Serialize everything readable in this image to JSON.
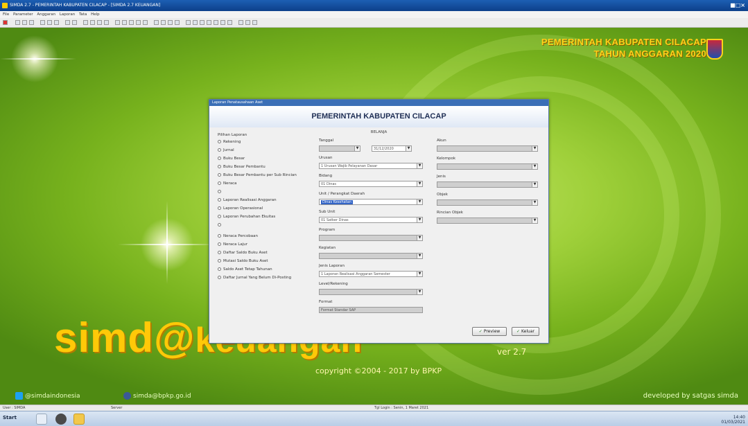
{
  "window": {
    "title": "SIMDA 2.7 - PEMERINTAH KABUPATEN CILACAP - [SIMDA 2.7 KEUANGAN]",
    "controls": "■□×"
  },
  "menu": [
    "File",
    "Parameter",
    "Anggaran",
    "Laporan",
    "Tata",
    "Help"
  ],
  "banner": {
    "line1": "PEMERINTAH KABUPATEN CILACAP",
    "line2": "TAHUN ANGGARAN 2020"
  },
  "branding": {
    "logo_main": "simd@",
    "logo_tail": "keuangan",
    "version": "ver 2.7",
    "copyright": "copyright ©2004 - 2017 by BPKP",
    "twitter": "@simdaindonesia",
    "facebook": "simda@bpkp.go.id",
    "developer": "developed by satgas simda"
  },
  "dialog": {
    "title": "Laporan Penatausahaan Aset",
    "header": "PEMERINTAH KABUPATEN CILACAP",
    "subheader": "BELANJA",
    "group_label": "Pilihan Laporan",
    "options": [
      {
        "label": "Rekening",
        "dim": false
      },
      {
        "label": "Jurnal",
        "dim": false
      },
      {
        "label": "Buku Besar",
        "dim": false
      },
      {
        "label": "Buku Besar Pembantu",
        "dim": false
      },
      {
        "label": "Buku Besar Pembantu per Sub Rincian",
        "dim": false
      },
      {
        "label": "Neraca",
        "dim": false
      },
      {
        "label": "",
        "dim": true
      },
      {
        "label": "Laporan Realisasi Anggaran",
        "dim": false
      },
      {
        "label": "Laporan Operasional",
        "dim": false
      },
      {
        "label": "Laporan Perubahan Ekuitas",
        "dim": false
      },
      {
        "label": "",
        "dim": true
      },
      {
        "label": "Neraca Percobaan",
        "dim": false
      },
      {
        "label": "Neraca Lajur",
        "dim": false
      },
      {
        "label": "Daftar Saldo Buku Aset",
        "dim": false
      },
      {
        "label": "Mutasi Saldo Buku Aset",
        "dim": false
      },
      {
        "label": "Saldo Aset Tetap Tahunan",
        "dim": false
      },
      {
        "label": "Daftar Jurnal Yang Belum Di-Posting",
        "dim": false
      }
    ],
    "fields": {
      "tanggal": {
        "label": "Tanggal",
        "value": "",
        "date": "31/12/2020"
      },
      "urusan": {
        "label": "Urusan",
        "value": "1 Urusan Wajib Pelayanan Dasar"
      },
      "bidang": {
        "label": "Bidang",
        "value": "01 Dinas"
      },
      "unit": {
        "label": "Unit / Perangkat Daerah",
        "value": "Dinas Kesehatan"
      },
      "subunit": {
        "label": "Sub Unit",
        "value": "01 Satker Dinas"
      },
      "program": {
        "label": "Program",
        "value": ""
      },
      "kegiatan": {
        "label": "Kegiatan",
        "value": ""
      },
      "jenis_laporan": {
        "label": "Jenis Laporan",
        "value": "1 Laporan Realisasi Anggaran Semester"
      },
      "level": {
        "label": "Level/Rekening",
        "value": ""
      },
      "format": {
        "label": "Format",
        "value": "Format Standar SAP"
      },
      "akun": {
        "label": "Akun",
        "value": ""
      },
      "kelompok": {
        "label": "Kelompok",
        "value": ""
      },
      "jenis": {
        "label": "Jenis",
        "value": ""
      },
      "objek": {
        "label": "Objek",
        "value": ""
      },
      "rincian": {
        "label": "Rincian Objek",
        "value": ""
      }
    },
    "buttons": {
      "preview": "Preview",
      "close": "Keluar"
    }
  },
  "statusbar": {
    "user": "User : SIMDA",
    "server": "Server",
    "db": "Tgl Login : Senin, 1 Maret 2021"
  },
  "taskbar": {
    "start": "Start",
    "clock": "14:40",
    "date": "01/03/2021"
  }
}
